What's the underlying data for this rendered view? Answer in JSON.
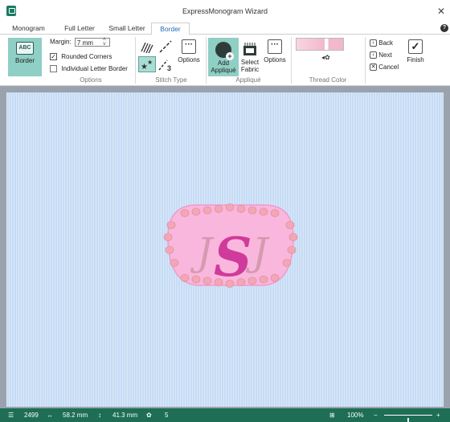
{
  "window": {
    "title": "ExpressMonogram Wizard"
  },
  "tabs": [
    {
      "label": "Monogram"
    },
    {
      "label": "Full Letter"
    },
    {
      "label": "Small Letter"
    },
    {
      "label": "Border"
    }
  ],
  "ribbon": {
    "border_button": {
      "icon_text": "ABC",
      "label": "Border"
    },
    "margin": {
      "label": "Margin:",
      "value": "7 mm"
    },
    "rounded_corners": {
      "label": "Rounded Corners",
      "checked": true
    },
    "individual_letter_border": {
      "label": "Individual Letter Border",
      "checked": false
    },
    "options_group_label": "Options",
    "stitch_type": {
      "options_label": "Options",
      "group_label": "Stitch Type",
      "stitch_badge": "3"
    },
    "applique": {
      "add_label_1": "Add",
      "add_label_2": "Appliqué",
      "select_label_1": "Select",
      "select_label_2": "Fabric",
      "options_label": "Options",
      "group_label": "Appliqué"
    },
    "thread_color": {
      "group_label": "Thread Color",
      "swatch_color": "#f2b8cc"
    },
    "nav": {
      "back": "Back",
      "next": "Next",
      "cancel": "Cancel",
      "finish": "Finish"
    }
  },
  "design": {
    "monogram_text": "SJ",
    "letter_left": "J",
    "letter_center": "S",
    "letter_right": "J",
    "applique_color": "#f9b7dd",
    "bead_color": "#f3a6b6",
    "letter_color_center": "#d03a9a",
    "letter_color_side": "#d49ab0"
  },
  "canvas_color": "#c6dcf5",
  "status": {
    "stitch_count": "2499",
    "width": "58.2 mm",
    "height": "41.3 mm",
    "colors": "5",
    "zoom": "100%",
    "zoom_fraction": 0.5
  }
}
